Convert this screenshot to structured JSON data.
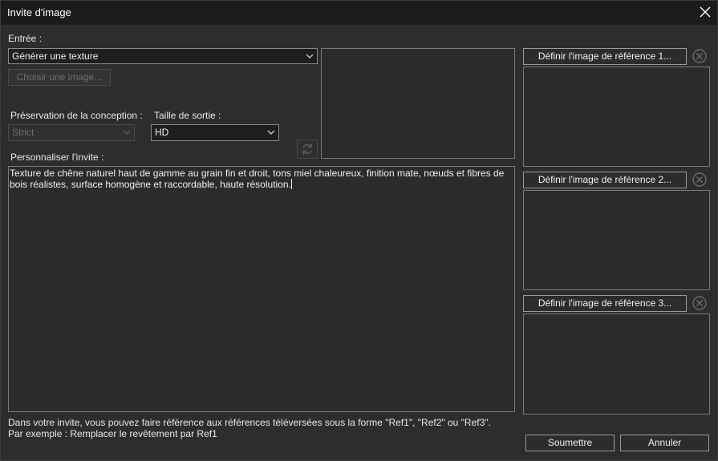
{
  "window": {
    "title": "Invite d'image"
  },
  "input_section": {
    "label": "Entrée :",
    "mode_value": "Générer une texture",
    "choose_image_label": "Choisir une image..."
  },
  "design_preservation": {
    "label": "Préservation de la conception :",
    "value": "Strict"
  },
  "output_size": {
    "label": "Taille de sortie :",
    "value": "HD"
  },
  "prompt": {
    "label": "Personnaliser l'invite :",
    "text": "Texture de chêne naturel haut de gamme au grain fin et droit, tons miel chaleureux, finition mate, nœuds et fibres de\nbois réalistes, surface homogène et raccordable, haute résolution."
  },
  "references": [
    {
      "button_label": "Définir l'image de référence 1..."
    },
    {
      "button_label": "Définir l'image de référence 2..."
    },
    {
      "button_label": "Définir l'image de référence 3..."
    }
  ],
  "footer": {
    "hint_line1": "Dans votre invite, vous pouvez faire référence aux références téléversées sous la forme \"Ref1\", \"Ref2\" ou \"Ref3\".",
    "hint_line2": "Par exemple : Remplacer le revêtement par Ref1",
    "submit_label": "Soumettre",
    "cancel_label": "Annuler"
  },
  "icons": {
    "close": "close-icon",
    "dropdown": "chevron-down-icon",
    "refresh": "refresh-icon",
    "remove": "circle-x-icon"
  },
  "colors": {
    "background": "#2d2d2d",
    "titlebar": "#1b1b1b",
    "field": "#1e1e1e",
    "border": "#7a7a7a",
    "text": "#e6e6e6",
    "disabled": "#6e6e6e"
  }
}
